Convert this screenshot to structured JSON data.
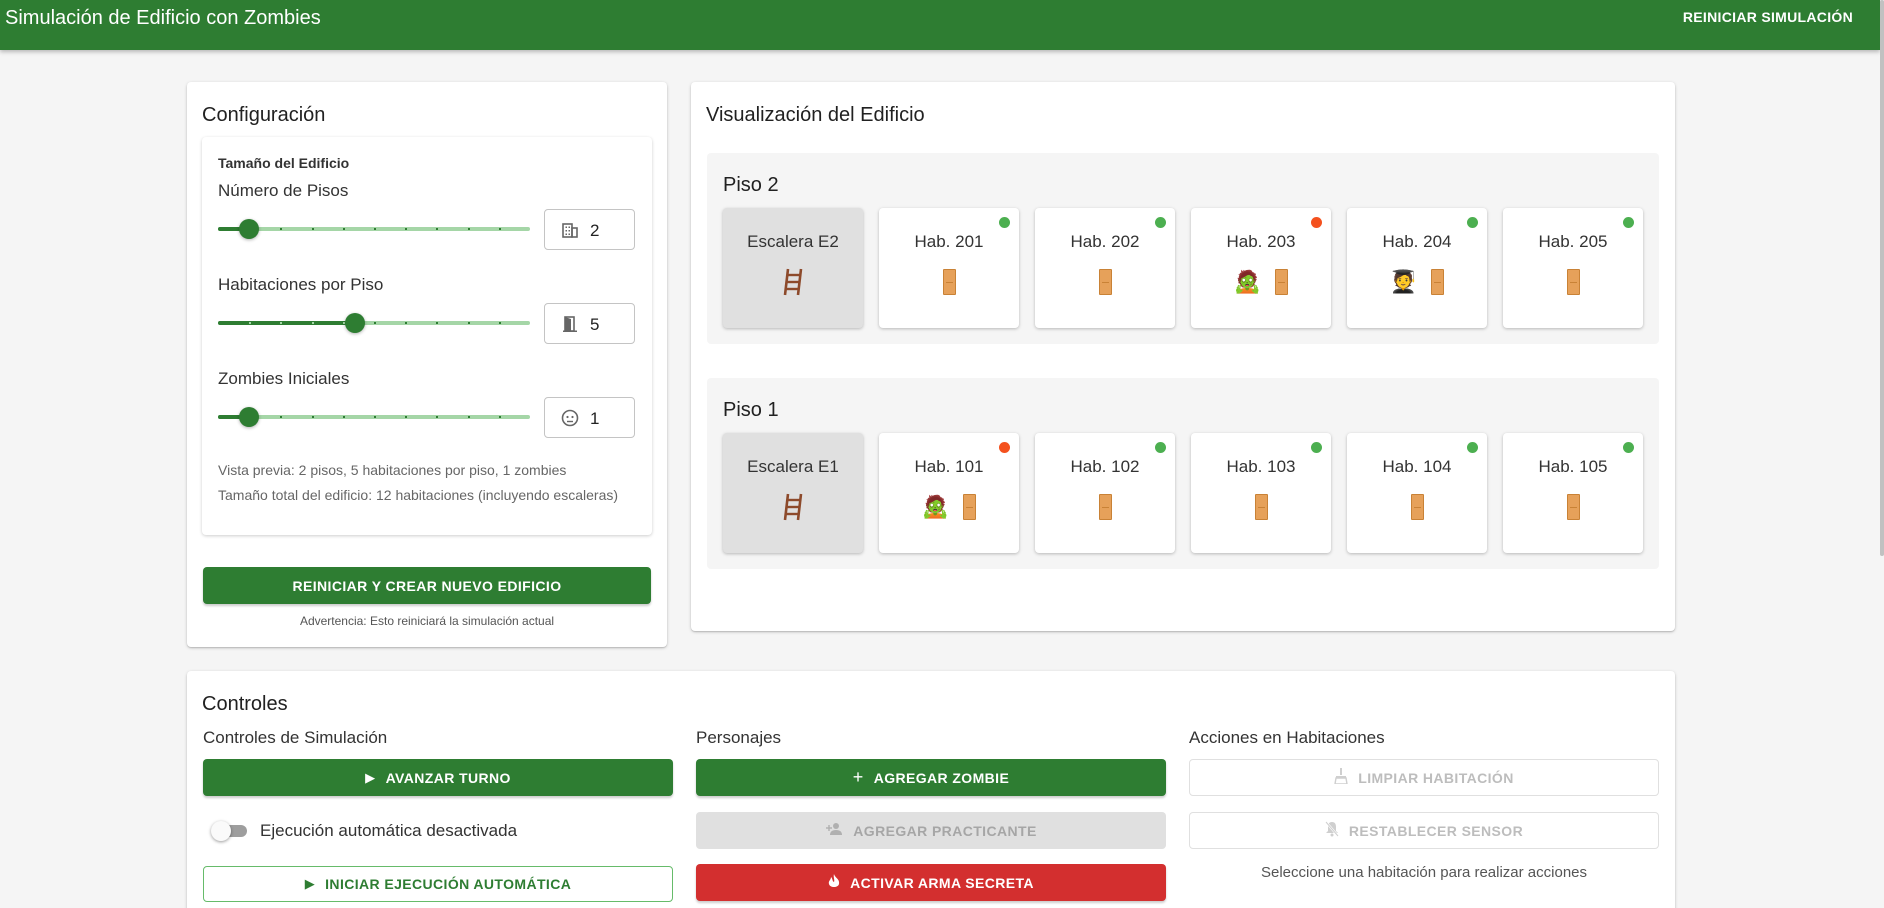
{
  "appbar": {
    "title": "Simulación de Edificio con Zombies",
    "reset_label": "REINICIAR SIMULACIÓN"
  },
  "config": {
    "title": "Configuración",
    "size_section": "Tamaño del Edificio",
    "floors": {
      "label": "Número de Pisos",
      "value": "2",
      "fraction": 0.1,
      "icon": "building-icon"
    },
    "rooms": {
      "label": "Habitaciones por Piso",
      "value": "5",
      "fraction": 0.44,
      "icon": "door-open-icon"
    },
    "zombies": {
      "label": "Zombies Iniciales",
      "value": "1",
      "fraction": 0.1,
      "icon": "zombie-face-icon"
    },
    "preview_line1": "Vista previa: 2 pisos, 5 habitaciones por piso, 1 zombies",
    "preview_line2": "Tamaño total del edificio: 12 habitaciones (incluyendo escaleras)",
    "reset_button": "REINICIAR Y CREAR NUEVO EDIFICIO",
    "warning": "Advertencia: Esto reiniciará la simulación actual"
  },
  "building": {
    "title": "Visualización del Edificio",
    "colors": {
      "ok": "#4caf50",
      "alert": "#f4511e"
    },
    "floors": [
      {
        "name": "Piso 2",
        "stair": "Escalera E2",
        "rooms": [
          {
            "name": "Hab. 201",
            "status": "ok",
            "occupant": ""
          },
          {
            "name": "Hab. 202",
            "status": "ok",
            "occupant": ""
          },
          {
            "name": "Hab. 203",
            "status": "alert",
            "occupant": "zombie"
          },
          {
            "name": "Hab. 204",
            "status": "ok",
            "occupant": "student"
          },
          {
            "name": "Hab. 205",
            "status": "ok",
            "occupant": ""
          }
        ]
      },
      {
        "name": "Piso 1",
        "stair": "Escalera E1",
        "rooms": [
          {
            "name": "Hab. 101",
            "status": "alert",
            "occupant": "zombie"
          },
          {
            "name": "Hab. 102",
            "status": "ok",
            "occupant": ""
          },
          {
            "name": "Hab. 103",
            "status": "ok",
            "occupant": ""
          },
          {
            "name": "Hab. 104",
            "status": "ok",
            "occupant": ""
          },
          {
            "name": "Hab. 105",
            "status": "ok",
            "occupant": ""
          }
        ]
      }
    ]
  },
  "controls": {
    "title": "Controles",
    "simulation": {
      "label": "Controles de Simulación",
      "advance": "AVANZAR TURNO",
      "auto_toggle": "Ejecución automática desactivada",
      "auto_enabled": false,
      "start_auto": "INICIAR EJECUCIÓN AUTOMÁTICA"
    },
    "characters": {
      "label": "Personajes",
      "add_zombie": "AGREGAR ZOMBIE",
      "add_intern": "AGREGAR PRACTICANTE",
      "secret_weapon": "ACTIVAR ARMA SECRETA"
    },
    "rooms": {
      "label": "Acciones en Habitaciones",
      "clean": "LIMPIAR HABITACIÓN",
      "reset_sensor": "RESTABLECER SENSOR",
      "hint": "Seleccione una habitación para realizar acciones"
    }
  }
}
